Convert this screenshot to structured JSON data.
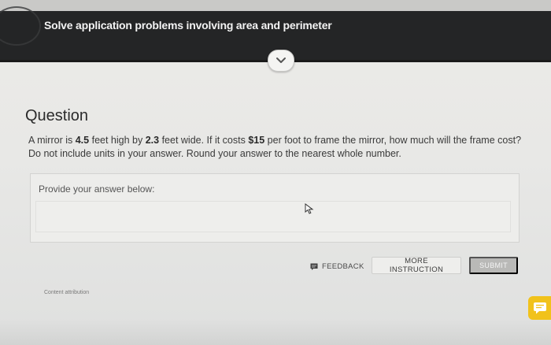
{
  "header": {
    "title": "Solve application problems involving area and perimeter"
  },
  "question": {
    "heading": "Question",
    "text_parts": {
      "p1": "A mirror is ",
      "height": "4.5",
      "p2": " feet high by ",
      "width": "2.3",
      "p3": " feet wide. If it costs ",
      "cost": "$15",
      "p4": " per foot to frame the mirror, how much will the frame cost? Do not include units in your answer. Round your answer to the nearest whole number."
    }
  },
  "answer": {
    "label": "Provide your answer below:",
    "value": ""
  },
  "buttons": {
    "feedback": "FEEDBACK",
    "more_instruction": "MORE INSTRUCTION",
    "submit": "SUBMIT"
  },
  "footer": {
    "attribution": "Content attribution"
  },
  "icons": {
    "collapse": "chevron-down-icon",
    "feedback": "feedback-icon",
    "chat": "chat-icon",
    "cursor": "pointer-cursor-icon"
  },
  "colors": {
    "header_bg": "#242526",
    "chat_accent": "#f1c21b",
    "submit_disabled": "#b9b9b7"
  }
}
